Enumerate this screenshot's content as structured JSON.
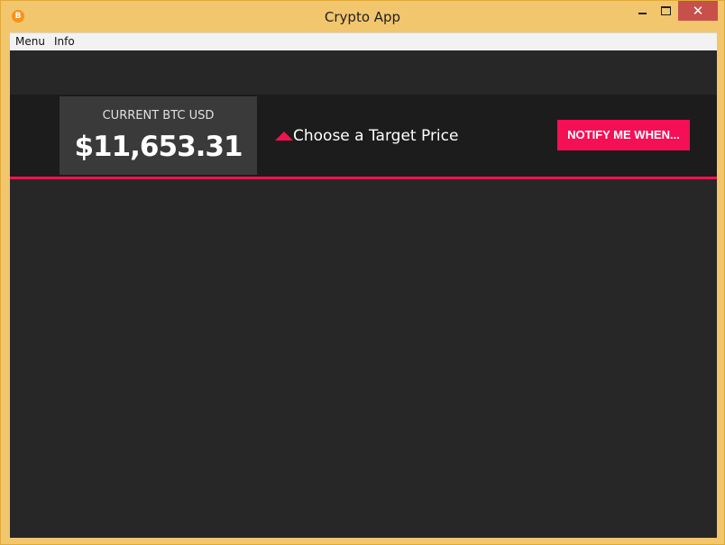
{
  "window": {
    "title": "Crypto App",
    "app_icon_glyph": "B",
    "close_glyph": "✕"
  },
  "menubar": {
    "items": [
      {
        "label": "Menu"
      },
      {
        "label": "Info"
      }
    ]
  },
  "price_card": {
    "label": "CURRENT BTC USD",
    "value": "$11,653.31"
  },
  "target": {
    "icon": "triangle-up-icon",
    "label": "Choose a Target Price"
  },
  "notify_button": {
    "label": "NOTIFY ME WHEN..."
  },
  "colors": {
    "accent": "#f0134d",
    "titlebar": "#f2c66d",
    "background": "#272727",
    "banner": "#1c1c1c",
    "card": "#3a3a3a",
    "close_button": "#c7504a"
  }
}
